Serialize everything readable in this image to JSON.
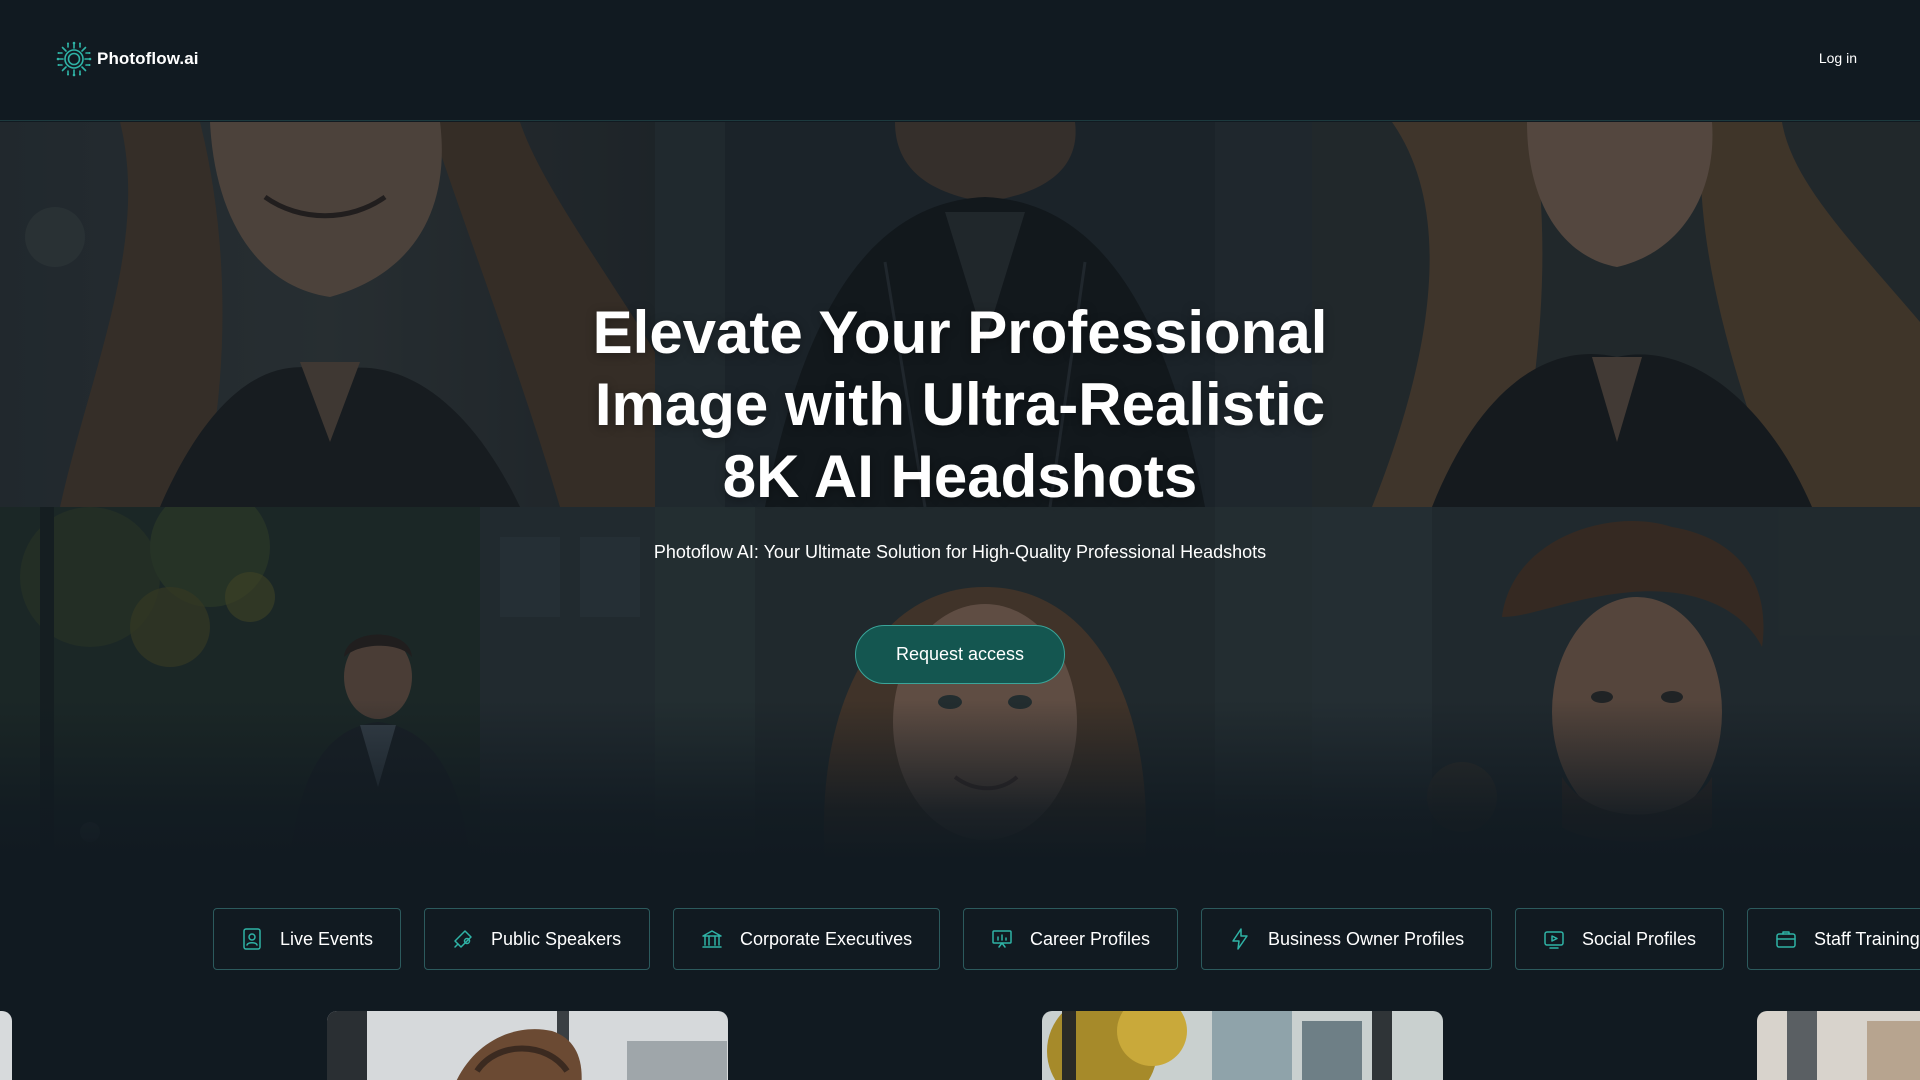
{
  "header": {
    "logo_text": "Photoflow.ai",
    "logo_icon": "sun-circuit-icon",
    "login_label": "Log in"
  },
  "hero": {
    "title_lines": [
      "Elevate Your Professional",
      "Image with Ultra-Realistic",
      "8K AI Headshots"
    ],
    "subtitle": "Photoflow AI: Your Ultimate Solution for High-Quality Professional Headshots",
    "cta_label": "Request access"
  },
  "categories": [
    {
      "label": "Live Events",
      "icon": "id-badge-icon"
    },
    {
      "label": "Public Speakers",
      "icon": "megaphone-icon"
    },
    {
      "label": "Corporate Executives",
      "icon": "bank-building-icon"
    },
    {
      "label": "Career Profiles",
      "icon": "presentation-chart-icon"
    },
    {
      "label": "Business Owner Profiles",
      "icon": "lightning-icon"
    },
    {
      "label": "Social Profiles",
      "icon": "play-video-icon"
    },
    {
      "label": "Staff Training",
      "icon": "briefcase-icon"
    }
  ],
  "colors": {
    "background": "#111a21",
    "accent": "#2a9d8f",
    "cta_fill": "#145650",
    "chip_border": "#2c5a5d"
  }
}
